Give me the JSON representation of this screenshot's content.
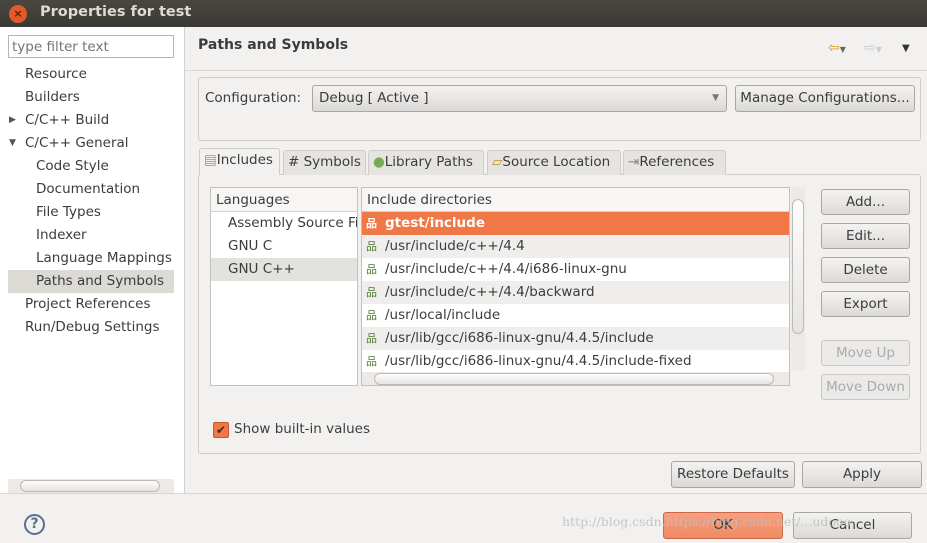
{
  "window": {
    "title": "Properties for test"
  },
  "sidebar": {
    "filter_placeholder": "type filter text",
    "items": [
      {
        "label": "Resource"
      },
      {
        "label": "Builders"
      },
      {
        "label": "C/C++ Build"
      },
      {
        "label": "C/C++ General"
      },
      {
        "label": "Code Style"
      },
      {
        "label": "Documentation"
      },
      {
        "label": "File Types"
      },
      {
        "label": "Indexer"
      },
      {
        "label": "Language Mappings"
      },
      {
        "label": "Paths and Symbols"
      },
      {
        "label": "Project References"
      },
      {
        "label": "Run/Debug Settings"
      }
    ]
  },
  "page": {
    "title": "Paths and Symbols"
  },
  "config": {
    "label": "Configuration:",
    "value": "Debug  [ Active ]",
    "manage": "Manage Configurations..."
  },
  "tabs": [
    {
      "label": "Includes"
    },
    {
      "label": "# Symbols"
    },
    {
      "label": "Library Paths"
    },
    {
      "label": "Source Location"
    },
    {
      "label": "References"
    }
  ],
  "languages": {
    "header": "Languages",
    "items": [
      "Assembly Source Fi",
      "GNU C",
      "GNU C++"
    ]
  },
  "includes": {
    "header": "Include directories",
    "items": [
      "gtest/include",
      "/usr/include/c++/4.4",
      "/usr/include/c++/4.4/i686-linux-gnu",
      "/usr/include/c++/4.4/backward",
      "/usr/local/include",
      "/usr/lib/gcc/i686-linux-gnu/4.4.5/include",
      "/usr/lib/gcc/i686-linux-gnu/4.4.5/include-fixed"
    ]
  },
  "buttons": {
    "add": "Add...",
    "edit": "Edit...",
    "delete": "Delete",
    "export": "Export",
    "move_up": "Move Up",
    "move_down": "Move Down",
    "restore": "Restore Defaults",
    "apply": "Apply",
    "ok": "OK",
    "cancel": "Cancel"
  },
  "show_builtin": {
    "label": "Show built-in values",
    "checked": true
  },
  "watermark": "http://blog.csdn.https://blog.csdn.net/...udooo",
  "colors": {
    "accent": "#f07746",
    "titlebar": "#3c3b37"
  }
}
